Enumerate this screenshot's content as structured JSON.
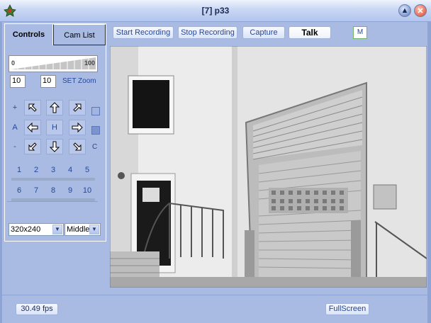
{
  "window": {
    "title": "[7] p33",
    "minimize_icon": "chevron-up-icon",
    "close_icon": "close-icon"
  },
  "tabs": [
    {
      "label": "Controls",
      "active": true
    },
    {
      "label": "Cam List",
      "active": false
    }
  ],
  "zoom": {
    "slider_min": "0",
    "slider_max": "100",
    "value_a": "10",
    "value_b": "10",
    "set_label": "SET Zoom"
  },
  "ptz": {
    "plus": "+",
    "a": "A",
    "minus": "-",
    "home": "H",
    "c": "C",
    "icons": [
      "arrow-up-left-icon",
      "arrow-up-icon",
      "arrow-up-right-icon",
      "arrow-left-icon",
      "arrow-right-icon",
      "arrow-down-left-icon",
      "arrow-down-icon",
      "arrow-down-right-icon"
    ]
  },
  "presets_row1": [
    "1",
    "2",
    "3",
    "4",
    "5"
  ],
  "presets_row2": [
    "6",
    "7",
    "8",
    "9",
    "10"
  ],
  "resolution": {
    "value": "320x240"
  },
  "quality": {
    "value": "Middle"
  },
  "toolbar": {
    "start_recording": "Start Recording",
    "stop_recording": "Stop Recording",
    "capture": "Capture",
    "talk": "Talk",
    "m": "M"
  },
  "status": {
    "fps": "30.49 fps",
    "fullscreen": "FullScreen"
  },
  "colors": {
    "background": "#a9bbe2",
    "accent_text": "#24479a",
    "frame": "#8ea4d4"
  }
}
